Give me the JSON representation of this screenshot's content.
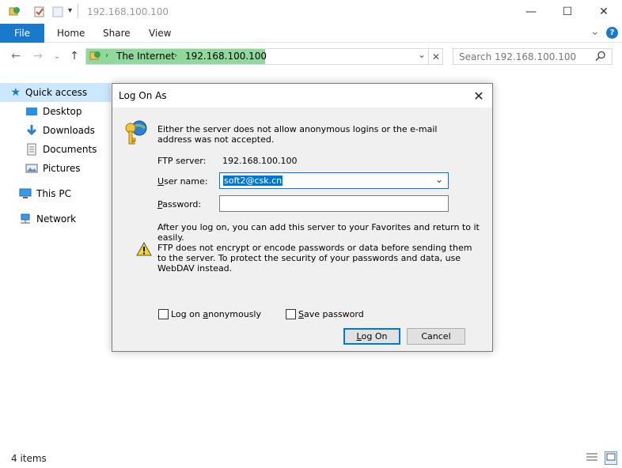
{
  "window": {
    "title": "192.168.100.100",
    "minimize": "—",
    "maximize": "☐",
    "close": "✕"
  },
  "ribbon": {
    "tabs": [
      "File",
      "Home",
      "Share",
      "View"
    ],
    "expand": "⌄",
    "help": "?"
  },
  "address": {
    "segments": [
      "The Internet",
      "192.168.100.100"
    ],
    "search_placeholder": "Search 192.168.100.100"
  },
  "nav": {
    "quick_access": "Quick access",
    "items": [
      "Desktop",
      "Downloads",
      "Documents",
      "Pictures"
    ],
    "this_pc": "This PC",
    "network": "Network"
  },
  "status": {
    "count": "4 items"
  },
  "dialog": {
    "title": "Log On As",
    "intro": "Either the server does not allow anonymous logins or the e-mail address was not accepted.",
    "ftp_label": "FTP server:",
    "ftp_value": "192.168.100.100",
    "user_label_u": "U",
    "user_label_rest": "ser name:",
    "user_value": "soft2@csk.cn",
    "pass_label_u": "P",
    "pass_label_rest": "assword:",
    "after_text": "After you log on, you can add this server to your Favorites and return to it easily.",
    "warning_text": "FTP does not encrypt or encode passwords or data before sending them to the server.  To protect the security of your passwords and data, use WebDAV instead.",
    "anon_pre": "Log on ",
    "anon_u": "a",
    "anon_rest": "nonymously",
    "save_u": "S",
    "save_rest": "ave password",
    "logon_u": "L",
    "logon_rest": "og On",
    "cancel": "Cancel"
  },
  "colors": {
    "accent": "#1979ca",
    "address_highlight": "#8fd99a",
    "selection": "#cce8ff"
  }
}
